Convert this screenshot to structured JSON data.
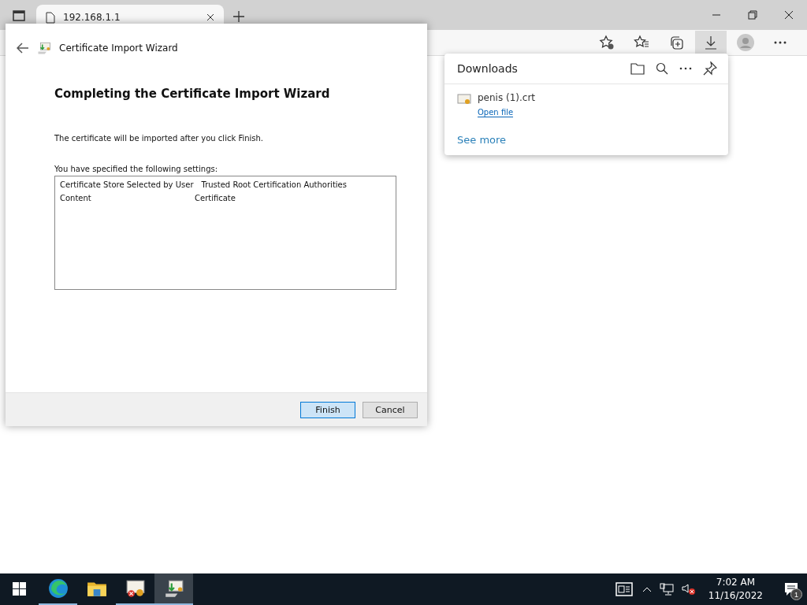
{
  "browser": {
    "tab": {
      "title": "192.168.1.1"
    },
    "toolbar": {
      "downloads_selected": true
    }
  },
  "downloads": {
    "title": "Downloads",
    "items": [
      {
        "name": "penis (1).crt",
        "action": "Open file"
      }
    ],
    "see_more": "See more"
  },
  "dialog": {
    "title": "Certificate Import Wizard",
    "heading": "Completing the Certificate Import Wizard",
    "message": "The certificate will be imported after you click Finish.",
    "settings_label": "You have specified the following settings:",
    "settings": [
      {
        "name": "Certificate Store Selected by User",
        "value": "Trusted Root Certification Authorities"
      },
      {
        "name": "Content",
        "value": "Certificate"
      }
    ],
    "buttons": [
      {
        "label": "Finish",
        "selected": true
      },
      {
        "label": "Cancel",
        "selected": false
      }
    ]
  },
  "taskbar": {
    "apps": [
      {
        "kind": "edge",
        "running": true,
        "selected": false
      },
      {
        "kind": "folder",
        "running": false,
        "selected": false
      },
      {
        "kind": "cert",
        "running": true,
        "selected": false
      },
      {
        "kind": "wizard",
        "running": true,
        "selected": true
      }
    ],
    "time": "7:02 AM",
    "date": "11/16/2022",
    "notifications": "1"
  }
}
